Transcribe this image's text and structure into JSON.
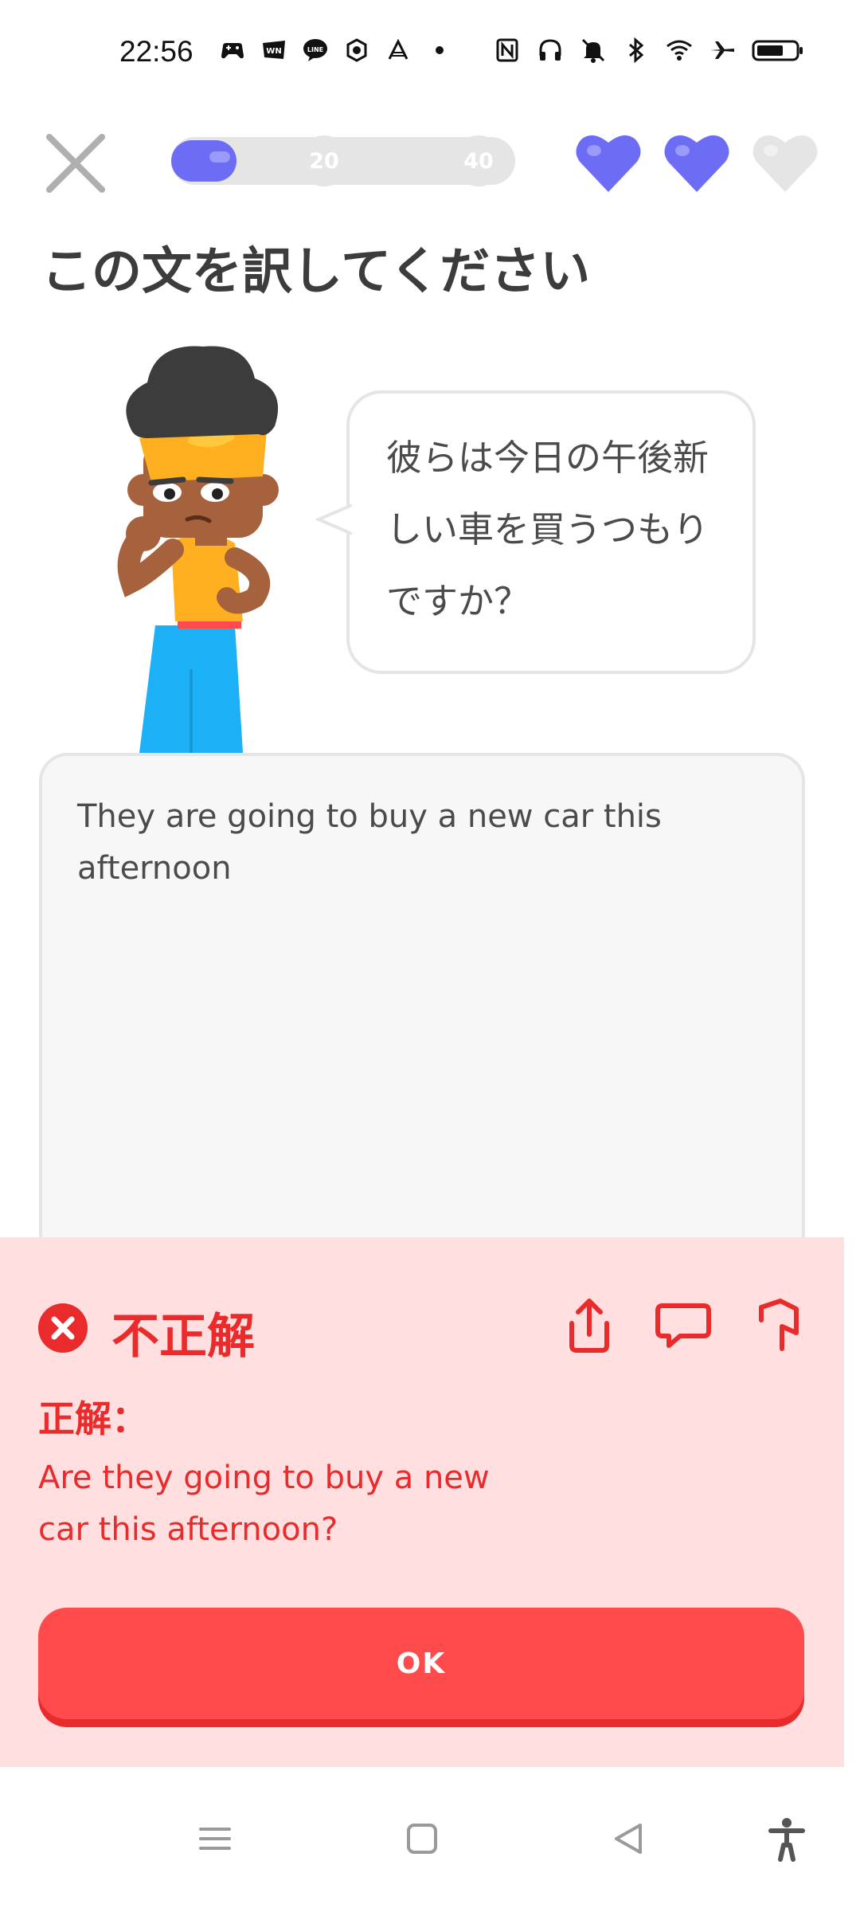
{
  "status_bar": {
    "time": "22:56",
    "left_icons": [
      "game-controller-icon",
      "webnovel-icon",
      "line-icon",
      "refresh-app-icon",
      "sparkle-app-icon",
      "dot-icon"
    ],
    "right_icons": [
      "nfc-icon",
      "headphones-icon",
      "mute-icon",
      "bluetooth-icon",
      "wifi-icon",
      "airplane-icon",
      "battery-icon"
    ]
  },
  "header": {
    "progress_fraction": 0.19,
    "milestones": [
      "20",
      "40"
    ],
    "hearts": [
      {
        "state": "filled",
        "color": "#6c6cf5"
      },
      {
        "state": "filled",
        "color": "#6c6cf5"
      },
      {
        "state": "empty",
        "color": "#e5e5e5"
      }
    ]
  },
  "prompt": {
    "title": "この文を訳してください",
    "sentence": "彼らは今日の午後新しい車を買うつもりですか？"
  },
  "answer": {
    "text": "They are going to buy a new car this afternoon"
  },
  "feedback": {
    "status": "不正解",
    "label": "正解：",
    "correct_answer": "Are they going to buy a new car this afternoon?",
    "actions": [
      "share-icon",
      "comment-icon",
      "flag-icon"
    ],
    "ok_label": "OK",
    "colors": {
      "background": "#ffdfe0",
      "accent": "#ea2b2b",
      "button": "#ff4b4b"
    }
  },
  "nav_bar": {
    "buttons": [
      "menu-icon",
      "home-square-icon",
      "back-triangle-icon",
      "accessibility-icon"
    ]
  }
}
